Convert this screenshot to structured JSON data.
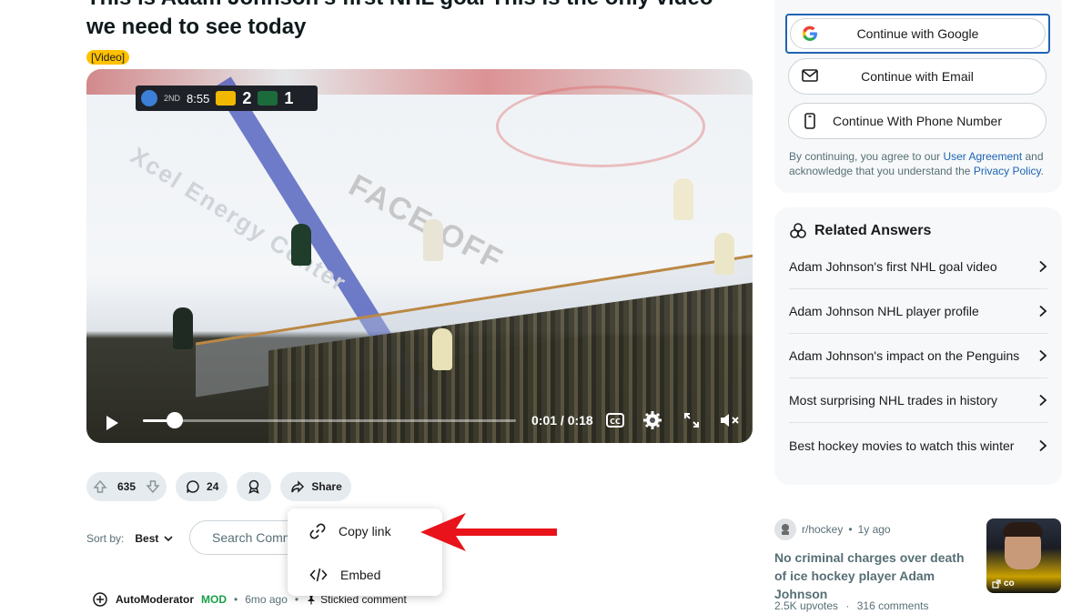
{
  "post": {
    "title": "This is Adam Johnson's first NHL goal This is the only video we need to see today",
    "flair": "[Video]"
  },
  "video": {
    "time": "0:01 / 0:18",
    "progress": 0.085,
    "scorebug": {
      "period": "2ND",
      "clock": "8:55",
      "home_score": "2",
      "away_score": "1"
    },
    "ice_text": "FACE-OFF",
    "ice_text2": "Xcel Energy Center"
  },
  "actions": {
    "votes": "635",
    "comments": "24",
    "share_label": "Share"
  },
  "share_menu": {
    "items": [
      {
        "label": "Copy link",
        "icon": "link-icon"
      },
      {
        "label": "Embed",
        "icon": "code-icon"
      }
    ]
  },
  "sort": {
    "label": "Sort by:",
    "value": "Best"
  },
  "search_comments": {
    "placeholder": "Search Comments"
  },
  "comment": {
    "author": "AutoModerator",
    "badge": "MOD",
    "age": "6mo ago",
    "separator": "•",
    "stickied": "Stickied comment"
  },
  "login": {
    "google": "Continue with Google",
    "email": "Continue with Email",
    "phone": "Continue With Phone Number",
    "terms_prefix": "By continuing, you agree to our ",
    "user_agreement": "User Agreement",
    "terms_middle": " and acknowledge that you understand the ",
    "privacy_policy": "Privacy Policy",
    "terms_suffix": "."
  },
  "related": {
    "heading": "Related Answers",
    "items": [
      "Adam Johnson's first NHL goal video",
      "Adam Johnson NHL player profile",
      "Adam Johnson's impact on the Penguins",
      "Most surprising NHL trades in history",
      "Best hockey movies to watch this winter"
    ]
  },
  "related_post": {
    "subreddit": "r/hockey",
    "age": "1y ago",
    "separator": "•",
    "title": "No criminal charges over death of ice hockey player Adam Johnson",
    "upvotes": "2.5K upvotes",
    "dot": "·",
    "comments": "316 comments",
    "thumb_badge": "co"
  },
  "colors": {
    "accent_blue": "#1e64b4",
    "flair_yellow": "#ffc100",
    "mod_green": "#18a04a",
    "annotation_red": "#e8131b"
  }
}
